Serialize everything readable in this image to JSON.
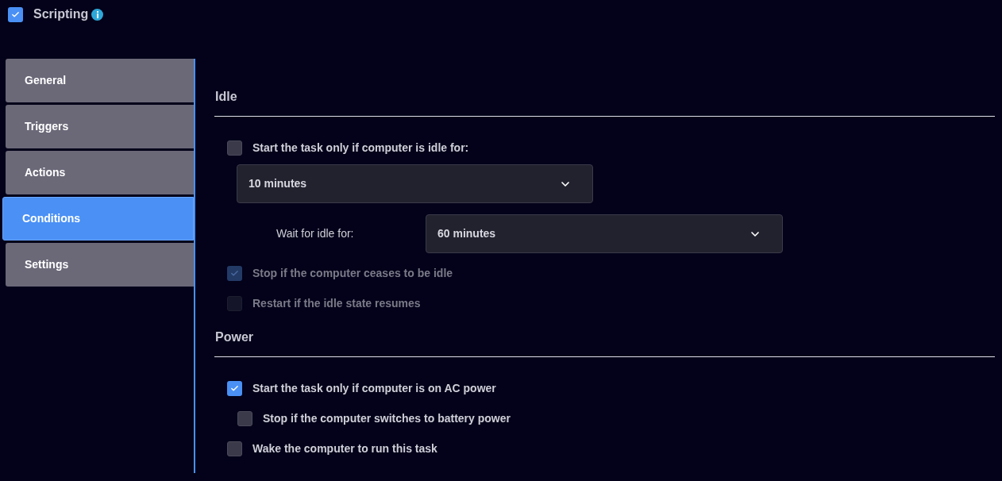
{
  "header": {
    "title": "Scripting",
    "checked": true
  },
  "tabs": [
    {
      "label": "General",
      "selected": false
    },
    {
      "label": "Triggers",
      "selected": false
    },
    {
      "label": "Actions",
      "selected": false
    },
    {
      "label": "Conditions",
      "selected": true
    },
    {
      "label": "Settings",
      "selected": false
    }
  ],
  "sections": [
    {
      "title": "Idle",
      "items": [
        {
          "kind": "checkbox",
          "label": "Start the task only if computer is idle for:",
          "checked": false,
          "disabled": false
        },
        {
          "kind": "dropdown",
          "value": "10 minutes"
        },
        {
          "kind": "labeled-dropdown",
          "label": "Wait for idle for:",
          "value": "60 minutes"
        },
        {
          "kind": "checkbox",
          "label": "Stop if the computer ceases to be idle",
          "checked": true,
          "disabled": true
        },
        {
          "kind": "checkbox",
          "label": "Restart if the idle state resumes",
          "checked": false,
          "disabled": true
        }
      ]
    },
    {
      "title": "Power",
      "items": [
        {
          "kind": "checkbox",
          "label": "Start the task only if computer is on AC power",
          "checked": true,
          "disabled": false,
          "children": [
            {
              "kind": "checkbox",
              "label": "Stop if the computer switches to battery power",
              "checked": false,
              "disabled": false
            }
          ]
        },
        {
          "kind": "checkbox",
          "label": "Wake the computer to run this task",
          "checked": false,
          "disabled": false
        }
      ]
    }
  ]
}
